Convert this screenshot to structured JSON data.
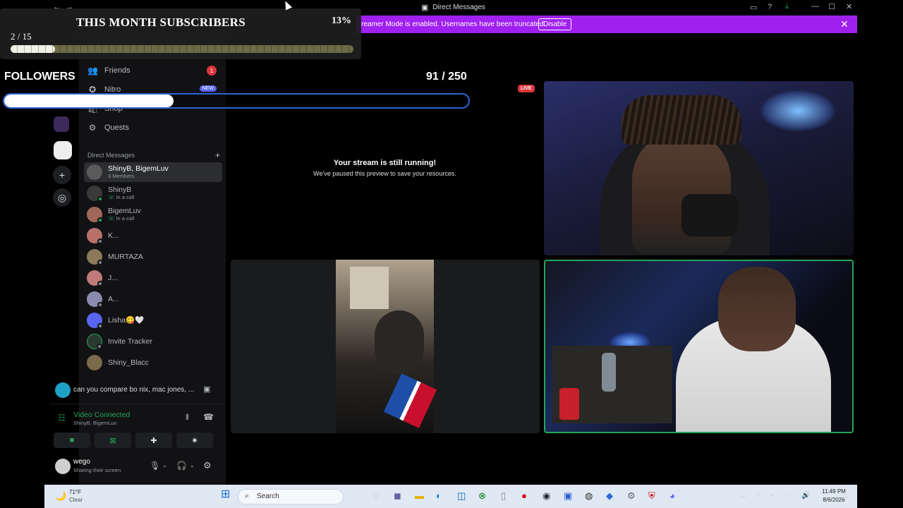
{
  "window": {
    "title": "Direct Messages"
  },
  "banner": {
    "message": "reamer Mode is enabled. Usernames have been truncated.",
    "disable_label": "Disable"
  },
  "overlay": {
    "subs_title": "THIS MONTH SUBSCRIBERS",
    "subs_percent": "13%",
    "subs_count": "2 / 15",
    "subs_progress": 0.13,
    "followers_label": "FOLLOWERS",
    "followers_count": "91 / 250",
    "followers_progress": 0.364
  },
  "sidebar": {
    "nav": [
      {
        "label": "Friends",
        "icon": "friends-icon",
        "badge": "1"
      },
      {
        "label": "Nitro",
        "icon": "nitro-icon",
        "badge": "NEW"
      },
      {
        "label": "Shop",
        "icon": "shop-icon"
      },
      {
        "label": "Quests",
        "icon": "quests-icon"
      }
    ],
    "dm_header": "Direct Messages",
    "dms": [
      {
        "name": "ShinyB, BigemLuv",
        "sub": "3 Members",
        "color": "#5a5a5a"
      },
      {
        "name": "ShinyB",
        "sub": "In a call",
        "color": "#3a3a3a"
      },
      {
        "name": "BigemLuv",
        "sub": "In a call",
        "color": "#a0685a"
      },
      {
        "name": "K...",
        "sub": "",
        "color": "#b8706a"
      },
      {
        "name": "MURTAZA",
        "sub": "",
        "color": "#8a7a5a"
      },
      {
        "name": "J...",
        "sub": "",
        "color": "#c07a7a"
      },
      {
        "name": "A...",
        "sub": "",
        "color": "#8a8ab0"
      },
      {
        "name": "Lisha😋🤍",
        "sub": "",
        "color": "#5865f2"
      },
      {
        "name": "Invite Tracker",
        "sub": "",
        "color": "#2b3a30"
      },
      {
        "name": "Shiny_Blacc",
        "sub": "",
        "color": "#7a6a4a"
      }
    ]
  },
  "activity": {
    "text": "can you compare bo nix, mac jones, ..."
  },
  "voice": {
    "status": "Video Connected",
    "members": "ShinyB, BigemLuv"
  },
  "user": {
    "name": "wego",
    "status": "Sharing their screen"
  },
  "stage": {
    "live_label": "LIVE",
    "stream_title": "Your stream is still running!",
    "stream_sub": "We've paused this preview to save your resources."
  },
  "taskbar": {
    "temp": "71°F",
    "weather": "Clear",
    "search": "Search",
    "time": "11:49 PM",
    "date": "8/6/2026"
  },
  "colors": {
    "banner": "#a020f0",
    "online": "#23a55a",
    "accent": "#5865f2",
    "live": "#da373c"
  }
}
